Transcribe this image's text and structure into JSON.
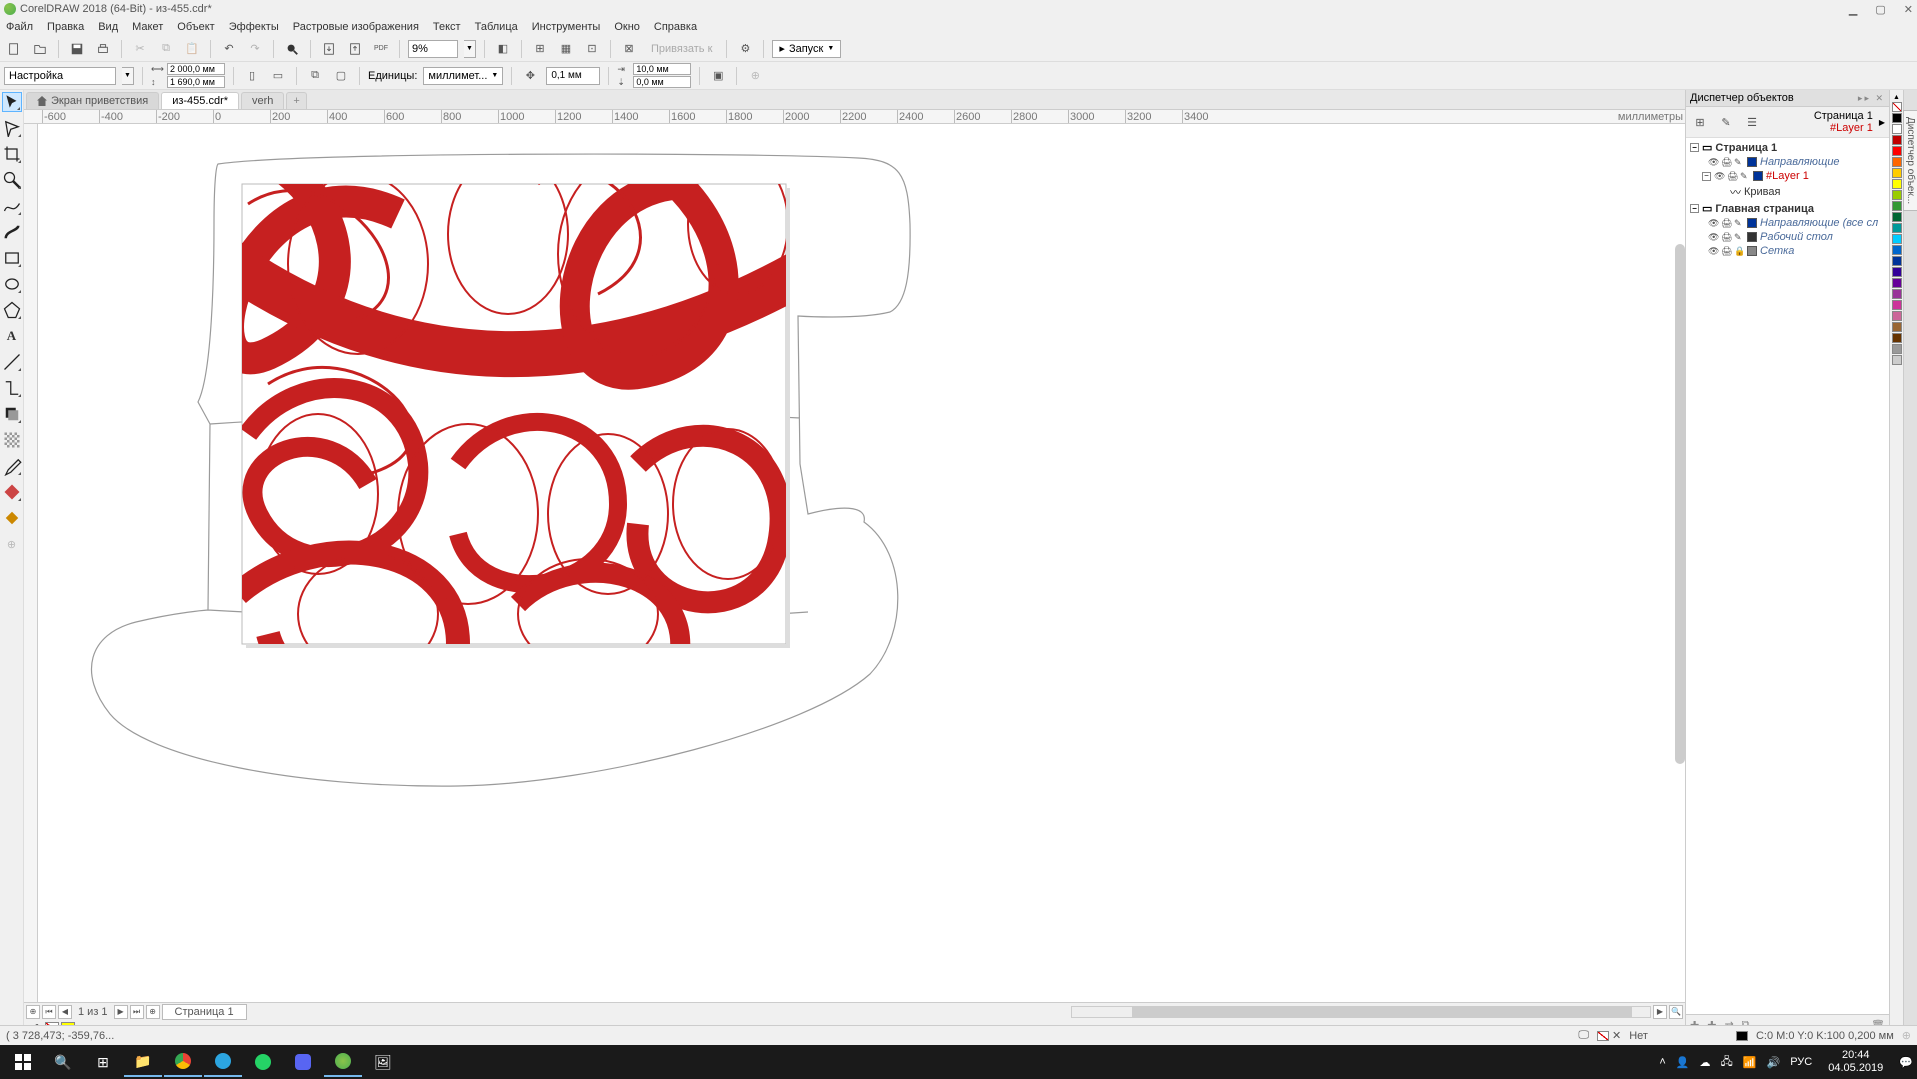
{
  "title": "CorelDRAW 2018 (64-Bit) - из-455.cdr*",
  "menu": [
    "Файл",
    "Правка",
    "Вид",
    "Макет",
    "Объект",
    "Эффекты",
    "Растровые изображения",
    "Текст",
    "Таблица",
    "Инструменты",
    "Окно",
    "Справка"
  ],
  "zoom": "9%",
  "snap_label": "Привязать к",
  "launch_label": "Запуск",
  "propbar": {
    "preset": "Настройка",
    "width": "2 000,0 мм",
    "height": "1 690,0 мм",
    "units_lbl": "Единицы:",
    "units_val": "миллимет...",
    "nudge": "0,1 мм",
    "dup_x": "10,0 мм",
    "dup_y": "0,0 мм"
  },
  "tabs": {
    "welcome": "Экран приветствия",
    "doc1": "из-455.cdr*",
    "doc2": "verh"
  },
  "ruler_unit": "миллиметры",
  "ruler_ticks": [
    "-600",
    "-400",
    "-200",
    "0",
    "200",
    "400",
    "600",
    "800",
    "1000",
    "1200",
    "1400",
    "1600",
    "1800",
    "2000",
    "2200",
    "2400",
    "2600",
    "2800",
    "3000",
    "3200",
    "3400"
  ],
  "page_nav": {
    "counter": "1  из  1",
    "page_tab": "Страница 1"
  },
  "object_manager": {
    "title": "Диспетчер объектов",
    "current_page": "Страница 1",
    "current_layer": "#Layer 1",
    "tree": {
      "page1": "Страница 1",
      "guides": "Направляющие",
      "layer1": "#Layer 1",
      "curve": "Кривая",
      "master": "Главная страница",
      "mguides": "Направляющие (все сл",
      "desktop": "Рабочий стол",
      "grid": "Сетка"
    }
  },
  "vtab": "Диспетчер объек...",
  "status": {
    "coords": "( 3 728,473; -359,76...",
    "fill": "Нет",
    "outline": "C:0 M:0 Y:0 K:100  0,200 мм"
  },
  "palette_colors": [
    "#000000",
    "#ffffff",
    "#c00000",
    "#ff0000",
    "#ff6600",
    "#ffcc00",
    "#ffff00",
    "#99cc00",
    "#339933",
    "#006633",
    "#009999",
    "#00ccff",
    "#0066cc",
    "#003399",
    "#330099",
    "#660099",
    "#993399",
    "#cc3399",
    "#cc6699",
    "#996633",
    "#663300",
    "#999999",
    "#cccccc"
  ],
  "taskbar": {
    "time": "20:44",
    "date": "04.05.2019",
    "lang": "РУС"
  }
}
